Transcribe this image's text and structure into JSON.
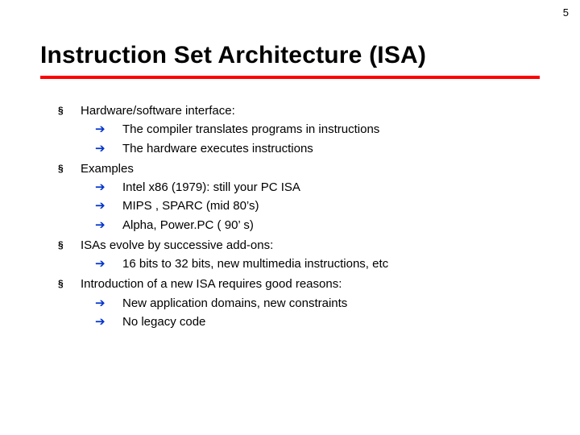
{
  "page_number": "5",
  "title": "Instruction Set Architecture (ISA)",
  "bullets": {
    "b1": "Hardware/software interface:",
    "b1_1": "The compiler translates programs in instructions",
    "b1_2": "The hardware executes instructions",
    "b2": "Examples",
    "b2_1": "Intel x86 (1979): still  your PC ISA",
    "b2_2": "MIPS , SPARC (mid 80’s)",
    "b2_3": "Alpha, Power.PC ( 90’ s)",
    "b3": "ISAs evolve by successive add-ons:",
    "b3_1": "16 bits to 32 bits,  new multimedia instructions, etc",
    "b4": "Introduction of a new ISA requires good reasons:",
    "b4_1": "New application domains, new constraints",
    "b4_2": "No legacy code"
  },
  "glyphs": {
    "square": "§",
    "arrow": "➔"
  }
}
